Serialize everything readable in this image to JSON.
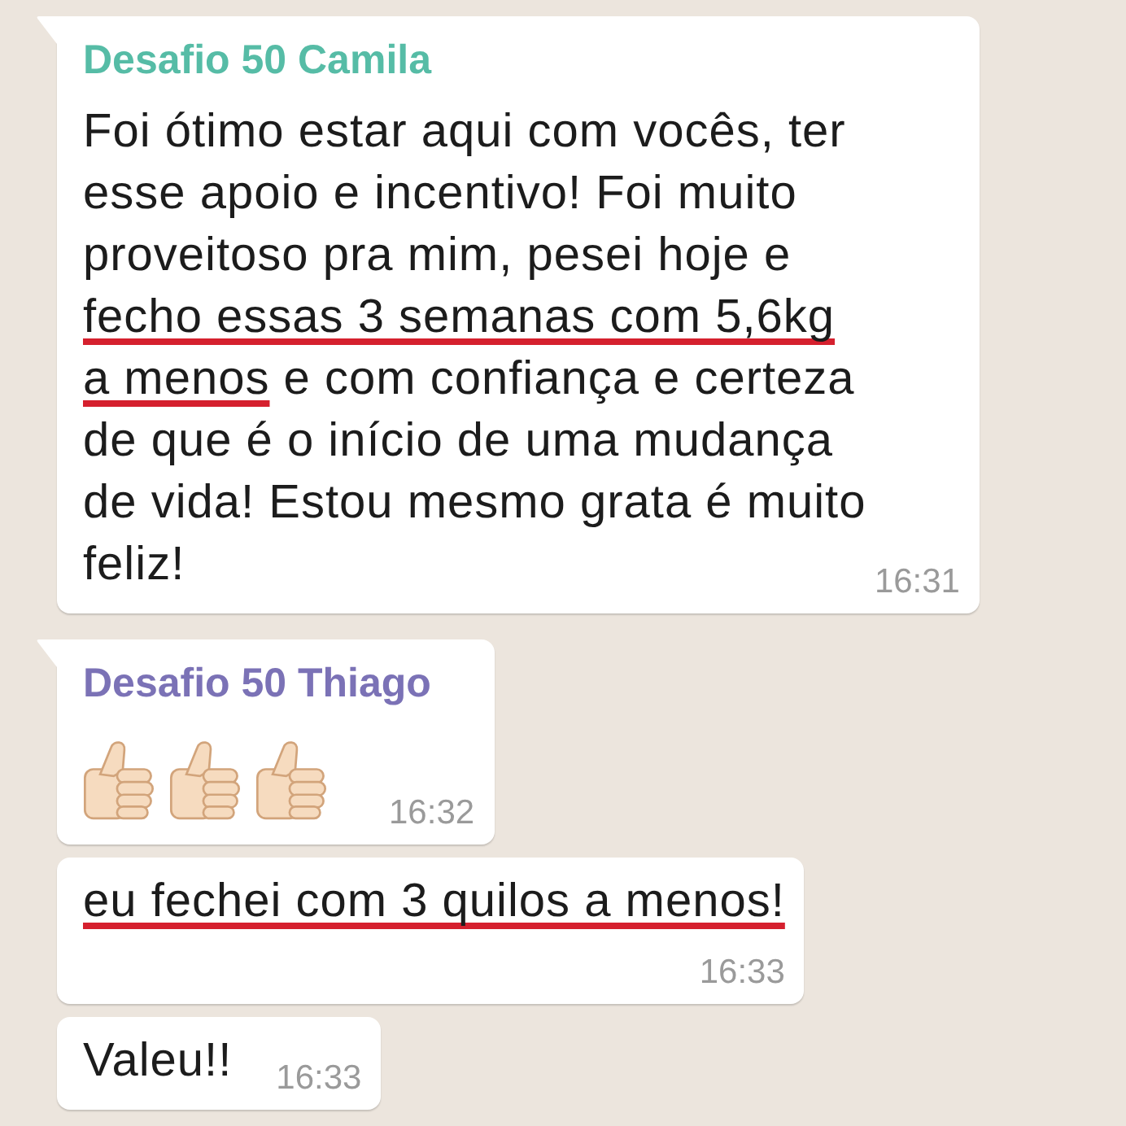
{
  "messages": [
    {
      "kind": "text",
      "sender": "Desafio 50 Camila",
      "color": "#56bca6",
      "tail": true,
      "segments": [
        {
          "text": "Foi ótimo estar aqui com vocês, ter esse apoio e incentivo! Foi muito proveitoso pra mim, pesei hoje e ",
          "underlined": false
        },
        {
          "text": "fecho essas 3 semanas com 5,6kg a menos",
          "underlined": true
        },
        {
          "text": " e com confiança e certeza de que é o início de uma mudança de vida! Estou mesmo grata é muito feliz!",
          "underlined": false
        }
      ],
      "time": "16:31"
    },
    {
      "kind": "emoji",
      "sender": "Desafio 50 Thiago",
      "color": "#7b72b6",
      "tail": true,
      "emojis": [
        {
          "kind": "thumbs_up"
        },
        {
          "kind": "thumbs_up"
        },
        {
          "kind": "thumbs_up"
        }
      ],
      "time": "16:32"
    },
    {
      "kind": "text",
      "tail": false,
      "segments": [
        {
          "text": "eu fechei com 3 quilos a menos!",
          "underlined": true
        }
      ],
      "time": "16:33"
    },
    {
      "kind": "text",
      "tail": false,
      "segments": [
        {
          "text": "Valeu!!",
          "underlined": false
        }
      ],
      "time": "16:33"
    }
  ]
}
